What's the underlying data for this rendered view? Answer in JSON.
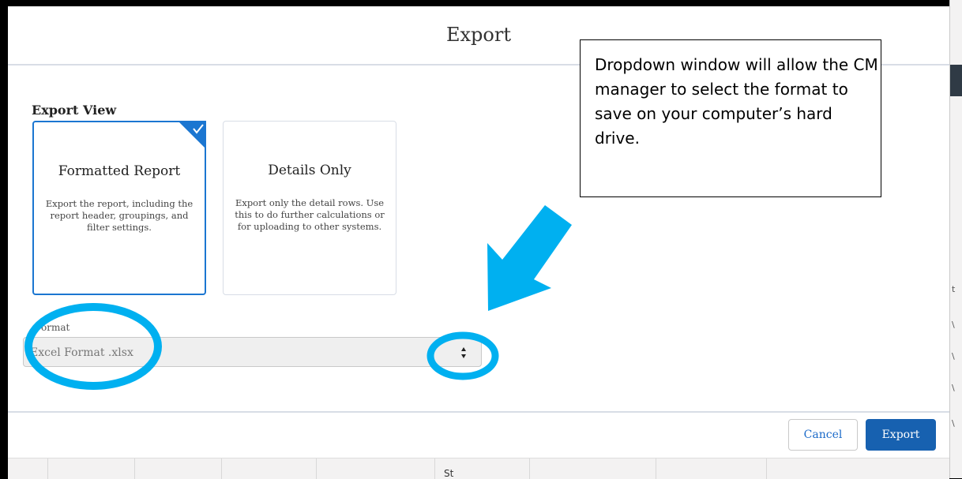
{
  "modal": {
    "title": "Export",
    "export_view_label": "Export View",
    "cards": [
      {
        "title": "Formatted Report",
        "description": "Export the report, including the report header, groupings, and filter settings.",
        "selected": true
      },
      {
        "title": "Details Only",
        "description": "Export only the detail rows. Use this to do further calculations or for uploading to other systems.",
        "selected": false
      }
    ],
    "format": {
      "label": "ormat",
      "value": "Excel Format .xlsx"
    },
    "buttons": {
      "cancel": "Cancel",
      "export": "Export"
    }
  },
  "annotation": {
    "callout": "Dropdown window will allow the CM manager to select the format to save on your computer’s hard drive.",
    "highlight_color": "#00b0f0"
  },
  "background": {
    "bottom_text": "St"
  },
  "colors": {
    "accent": "#1b76d1",
    "primary_button": "#1761b0"
  }
}
